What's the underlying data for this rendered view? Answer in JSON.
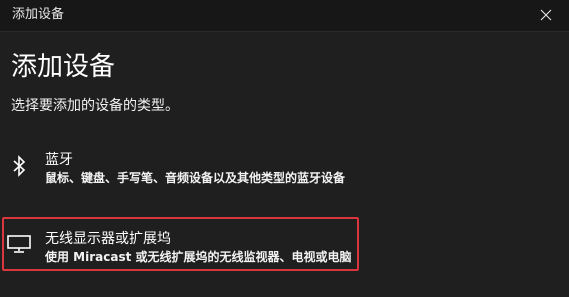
{
  "window": {
    "title": "添加设备",
    "close_icon": "close-icon"
  },
  "main": {
    "heading": "添加设备",
    "subheading": "选择要添加的设备的类型。"
  },
  "options": [
    {
      "icon": "bluetooth-icon",
      "title": "蓝牙",
      "description": "鼠标、键盘、手写笔、音频设备以及其他类型的蓝牙设备"
    },
    {
      "icon": "monitor-icon",
      "title": "无线显示器或扩展坞",
      "description": "使用 Miracast 或无线扩展坞的无线监视器、电视或电脑"
    }
  ],
  "annotation": {
    "highlight_color": "#d9363e"
  }
}
